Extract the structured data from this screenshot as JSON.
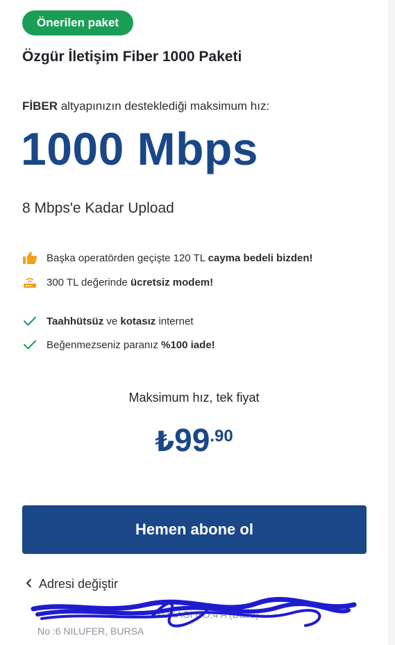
{
  "badge": "Önerilen paket",
  "package_title": "Özgür İletişim Fiber 1000 Paketi",
  "speed_desc": {
    "bold": "FİBER",
    "rest": " altyapınızın desteklediği maksimum hız:"
  },
  "speed": "1000 Mbps",
  "upload": "8 Mbps'e Kadar Upload",
  "features": [
    {
      "icon": "thumbs-up-icon",
      "parts": [
        {
          "text": "Başka operatörden geçişte 120 TL ",
          "bold": false
        },
        {
          "text": "cayma bedeli bizden!",
          "bold": true
        }
      ]
    },
    {
      "icon": "modem-icon",
      "parts": [
        {
          "text": "300 TL değerinde ",
          "bold": false
        },
        {
          "text": "ücretsiz modem!",
          "bold": true
        }
      ]
    },
    {
      "icon": "check-icon",
      "parts": [
        {
          "text": "Taahhütsüz",
          "bold": true
        },
        {
          "text": " ve ",
          "bold": false
        },
        {
          "text": "kotasız",
          "bold": true
        },
        {
          "text": " internet",
          "bold": false
        }
      ]
    },
    {
      "icon": "check-icon",
      "parts": [
        {
          "text": "Beğenmezseniz paranız ",
          "bold": false
        },
        {
          "text": "%100 iade!",
          "bold": true
        }
      ]
    }
  ],
  "price": {
    "caption": "Maksimum hız, tek fiyat",
    "currency": "₺",
    "integer": "99",
    "decimal": ".90"
  },
  "cta_label": "Hemen abone ol",
  "change_address": "Adresi değiştir",
  "address": {
    "line1": "SOKAGI NO:4 A (Daire)",
    "line2": "No :6 NILUFER, BURSA"
  },
  "colors": {
    "brand_blue": "#1a4787",
    "badge_green": "#1a9e55",
    "accent_orange": "#f2a11b",
    "check_green": "#1a9e55",
    "scribble_blue": "#1f1ccf"
  }
}
